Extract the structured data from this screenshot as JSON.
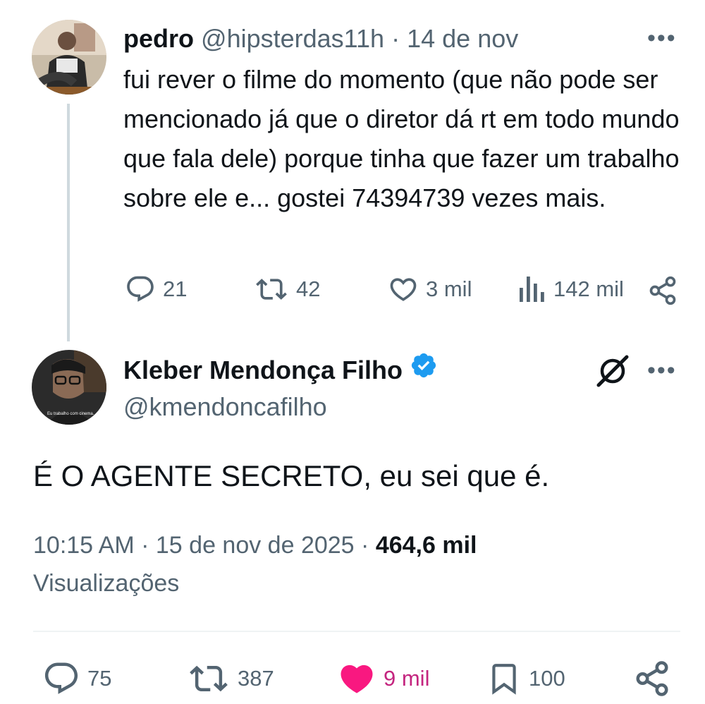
{
  "reply_tweet": {
    "name": "pedro",
    "handle": "@hipsterdas11h",
    "dot": "·",
    "date": "14 de nov",
    "more": "•••",
    "text": "fui rever o filme do momento (que não pode ser mencionado já que o diretor dá rt em todo mundo que fala dele) porque tinha que fazer um trabalho sobre ele e... gostei 74394739 vezes mais.",
    "replies": "21",
    "reposts": "42",
    "likes": "3 mil",
    "views": "142 mil"
  },
  "main_tweet": {
    "name": "Kleber Mendonça Filho",
    "handle": "@kmendoncafilho",
    "more": "•••",
    "text": "É O AGENTE SECRETO, eu sei que é.",
    "time": "10:15 AM",
    "dot1": "·",
    "date": "15 de nov de 2025",
    "dot2": "·",
    "views_count": "464,6 mil",
    "views_label": "Visualizações",
    "avatar_caption": "Eu trabalho com cinema.",
    "replies": "75",
    "reposts": "387",
    "likes": "9 mil",
    "bookmarks": "100"
  },
  "colors": {
    "text": "#0f1419",
    "muted": "#536471",
    "like_active": "#f91880",
    "verified": "#1d9bf0",
    "divider": "#eff3f4"
  },
  "icons": [
    "reply-icon",
    "repost-icon",
    "like-icon",
    "views-icon",
    "share-icon",
    "verified-badge-icon",
    "grok-icon",
    "bookmark-icon",
    "more-icon"
  ]
}
